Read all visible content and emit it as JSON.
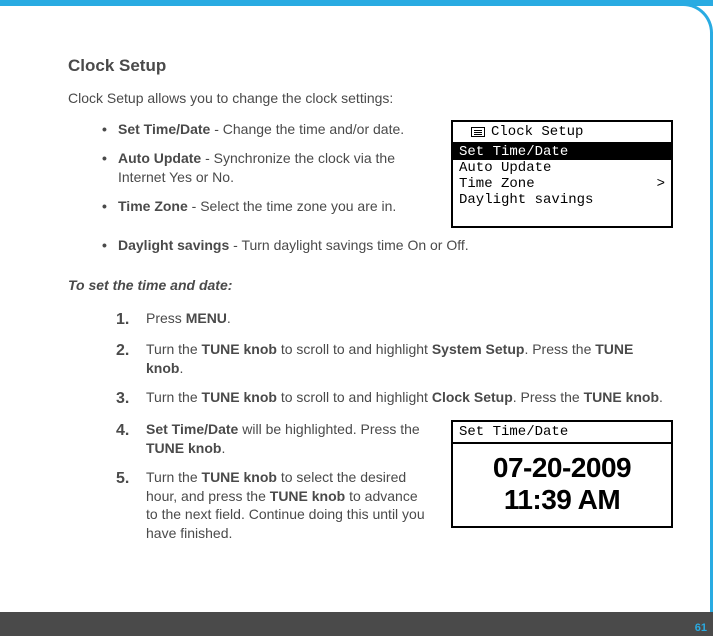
{
  "page": {
    "title": "Clock Setup",
    "intro": "Clock Setup allows you to change the clock settings:",
    "pageNumber": "61"
  },
  "bullets": [
    {
      "term": "Set Time/Date",
      "desc": " - Change the time and/or date."
    },
    {
      "term": "Auto Update",
      "desc": " - Synchronize the clock via the Internet Yes or No."
    },
    {
      "term": "Time Zone",
      "desc": " - Select the time zone you are in."
    },
    {
      "term": "Daylight savings",
      "desc": " - Turn daylight savings time On or Off."
    }
  ],
  "menuScreen": {
    "title": "Clock Setup",
    "items": [
      {
        "label": "Set Time/Date",
        "selected": true,
        "arrow": ""
      },
      {
        "label": "Auto Update",
        "selected": false,
        "arrow": ""
      },
      {
        "label": "Time Zone",
        "selected": false,
        "arrow": ">"
      },
      {
        "label": "Daylight savings",
        "selected": false,
        "arrow": ""
      }
    ]
  },
  "procedure": {
    "heading": "To set the time and date:",
    "steps": {
      "s1": {
        "num": "1.",
        "pre": "Press ",
        "b1": "MENU",
        "post": "."
      },
      "s2": {
        "num": "2.",
        "pre": "Turn the ",
        "b1": "TUNE knob",
        "mid1": " to scroll to and highlight ",
        "b2": "System Setup",
        "mid2": ". Press the ",
        "b3": "TUNE knob",
        "post": "."
      },
      "s3": {
        "num": "3.",
        "pre": "Turn the ",
        "b1": "TUNE knob",
        "mid1": " to scroll to and highlight ",
        "b2": "Clock Setup",
        "mid2": ". Press the ",
        "b3": "TUNE knob",
        "post": "."
      },
      "s4": {
        "num": "4.",
        "b1": "Set Time/Date",
        "mid1": " will be highlighted. Press the ",
        "b2": "TUNE knob",
        "post": "."
      },
      "s5": {
        "num": "5.",
        "pre": "Turn the ",
        "b1": "TUNE knob",
        "mid1": " to select the desired hour, and press the ",
        "b2": "TUNE knob",
        "post": " to advance to the next field. Continue doing this until you have finished."
      }
    }
  },
  "timeScreen": {
    "title": "Set Time/Date",
    "date": "07-20-2009",
    "time": "11:39 AM"
  }
}
